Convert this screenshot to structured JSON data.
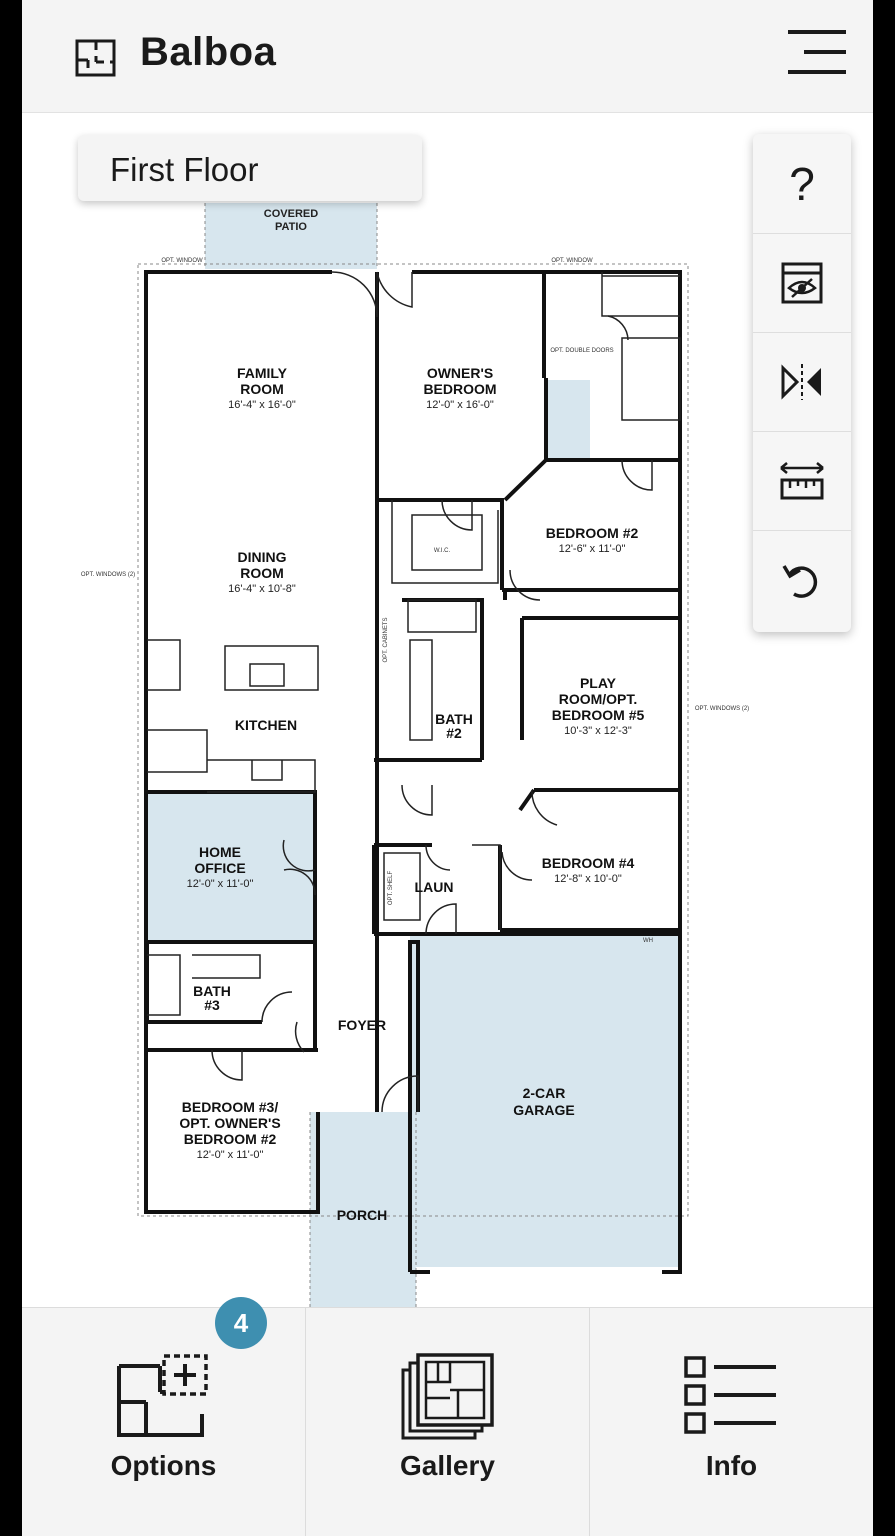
{
  "app": {
    "title": "Balboa"
  },
  "floor_selector": {
    "label": "First Floor"
  },
  "toolbar": {
    "help_label": "?"
  },
  "floorplan": {
    "covered_patio": [
      "COVERED",
      "PATIO"
    ],
    "opt_window": "OPT. WINDOW",
    "opt_windows_2": "OPT. WINDOWS (2)",
    "family_room": {
      "name": [
        "FAMILY",
        "ROOM"
      ],
      "size": "16'-4\" x 16'-0\""
    },
    "owners_bedroom": {
      "name": [
        "OWNER'S",
        "BEDROOM"
      ],
      "size": "12'-0\" x 16'-0\""
    },
    "opt_double_doors": "OPT. DOUBLE DOORS",
    "wic": "W.I.C.",
    "dining_room": {
      "name": [
        "DINING",
        "ROOM"
      ],
      "size": "16'-4\" x 10'-8\""
    },
    "bedroom_2": {
      "name": "BEDROOM #2",
      "size": "12'-6\" x 11'-0\""
    },
    "play_room": {
      "name": [
        "PLAY",
        "ROOM/OPT.",
        "BEDROOM #5"
      ],
      "size": "10'-3\" x 12'-3\""
    },
    "kitchen": "KITCHEN",
    "bath_2": [
      "BATH",
      "#2"
    ],
    "opt_cabinets": "OPT. CABINETS",
    "home_office": {
      "name": [
        "HOME",
        "OFFICE"
      ],
      "size": "12'-0\" x 11'-0\""
    },
    "laun": "LAUN",
    "opt_shelf": "OPT. SHELF",
    "bedroom_4": {
      "name": "BEDROOM #4",
      "size": "12'-8\" x 10'-0\""
    },
    "bath_3": [
      "BATH",
      "#3"
    ],
    "foyer": "FOYER",
    "garage": [
      "2-CAR",
      "GARAGE"
    ],
    "bedroom_3": {
      "name": [
        "BEDROOM #3/",
        "OPT. OWNER'S",
        "BEDROOM #2"
      ],
      "size": "12'-0\" x 11'-0\""
    },
    "porch": "PORCH",
    "wh": "WH"
  },
  "bottom_nav": {
    "options": {
      "label": "Options",
      "badge": "4"
    },
    "gallery": {
      "label": "Gallery"
    },
    "info": {
      "label": "Info"
    }
  },
  "colors": {
    "accent": "#3e8fb0",
    "room_fill": "#d7e6ee",
    "wall": "#111111"
  }
}
